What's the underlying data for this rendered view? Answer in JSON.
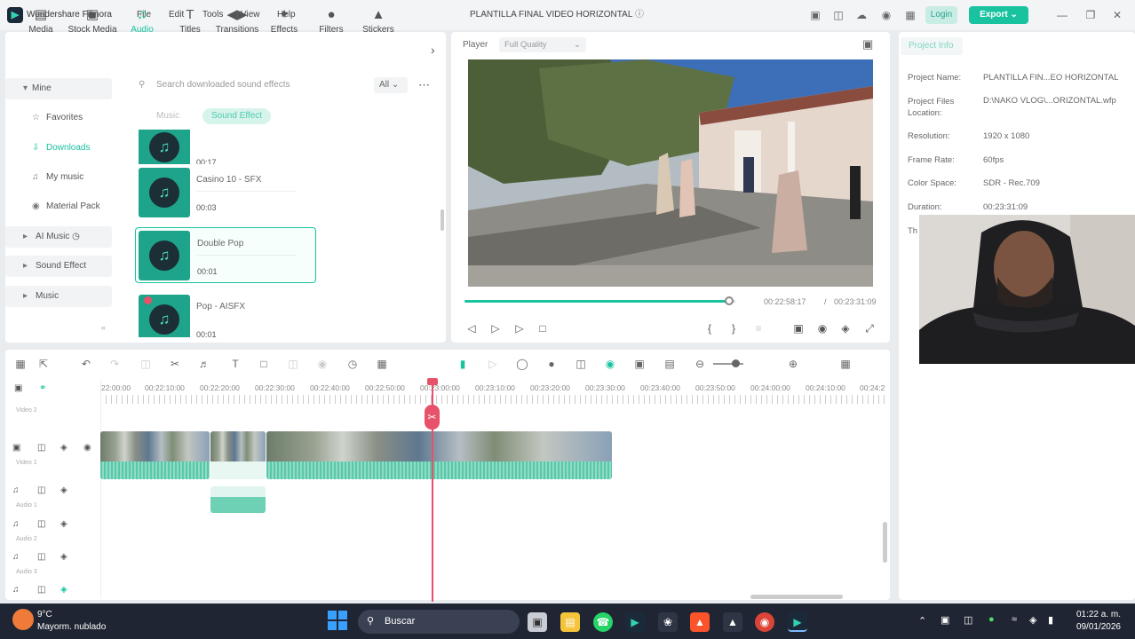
{
  "app": {
    "name": "Wondershare Filmora",
    "menu": [
      "File",
      "Edit",
      "Tools",
      "View",
      "Help"
    ],
    "project_title": "PLANTILLA FINAL VIDEO HORIZONTAL",
    "login_label": "Login",
    "export_label": "Export"
  },
  "library": {
    "categories": [
      {
        "label": "Media",
        "icon": "media-icon"
      },
      {
        "label": "Stock Media",
        "icon": "stock-media-icon"
      },
      {
        "label": "Audio",
        "icon": "audio-icon"
      },
      {
        "label": "Titles",
        "icon": "titles-icon"
      },
      {
        "label": "Transitions",
        "icon": "transitions-icon"
      },
      {
        "label": "Effects",
        "icon": "effects-icon"
      },
      {
        "label": "Filters",
        "icon": "filters-icon"
      },
      {
        "label": "Stickers",
        "icon": "stickers-icon"
      }
    ],
    "sidebar": {
      "mine": "Mine",
      "favorites": "Favorites",
      "downloads": "Downloads",
      "my_music": "My music",
      "material_pack": "Material Pack",
      "ai_music": "AI Music",
      "sound_effect": "Sound Effect",
      "music": "Music"
    },
    "search_placeholder": "Search downloaded sound effects",
    "filter_value": "All",
    "tabs": {
      "music": "Music",
      "sound_effect": "Sound Effect"
    },
    "sounds": [
      {
        "name": "",
        "duration": "00:17"
      },
      {
        "name": "Casino 10 - SFX",
        "duration": "00:03"
      },
      {
        "name": "Double Pop",
        "duration": "00:01"
      },
      {
        "name": "Pop - AISFX",
        "duration": "00:01"
      }
    ]
  },
  "player": {
    "label": "Player",
    "quality": "Full Quality",
    "current_time": "00:22:58:17",
    "separator": "/",
    "total_time": "00:23:31:09",
    "progress_fraction": 0.98
  },
  "project_info": {
    "tab": "Project Info",
    "rows": [
      {
        "label": "Project Name:",
        "value": "PLANTILLA FIN...EO HORIZONTAL"
      },
      {
        "label": "Project Files Location:",
        "value": "D:\\NAKO VLOG\\...ORIZONTAL.wfp"
      },
      {
        "label": "Resolution:",
        "value": "1920 x 1080"
      },
      {
        "label": "Frame Rate:",
        "value": "60fps"
      },
      {
        "label": "Color Space:",
        "value": "SDR - Rec.709"
      },
      {
        "label": "Duration:",
        "value": "00:23:31:09"
      }
    ],
    "partial_label": "Th"
  },
  "timeline": {
    "ruler": [
      "22:00:00",
      "00:22:10:00",
      "00:22:20:00",
      "00:22:30:00",
      "00:22:40:00",
      "00:22:50:00",
      "00:23:00:00",
      "00:23:10:00",
      "00:23:20:00",
      "00:23:30:00",
      "00:23:40:00",
      "00:23:50:00",
      "00:24:00:00",
      "00:24:10:00",
      "00:24:2"
    ],
    "tracks": [
      "Video 2",
      "Video 1",
      "Audio 1",
      "Audio 2",
      "Audio 3"
    ]
  },
  "taskbar": {
    "weather_temp": "9°C",
    "weather_desc": "Mayorm. nublado",
    "search_label": "Buscar",
    "time": "01:22 a. m.",
    "date": "09/01/2026"
  },
  "colors": {
    "accent": "#19c3a0",
    "playhead": "#e8516a",
    "taskbar": "#1f2533"
  }
}
